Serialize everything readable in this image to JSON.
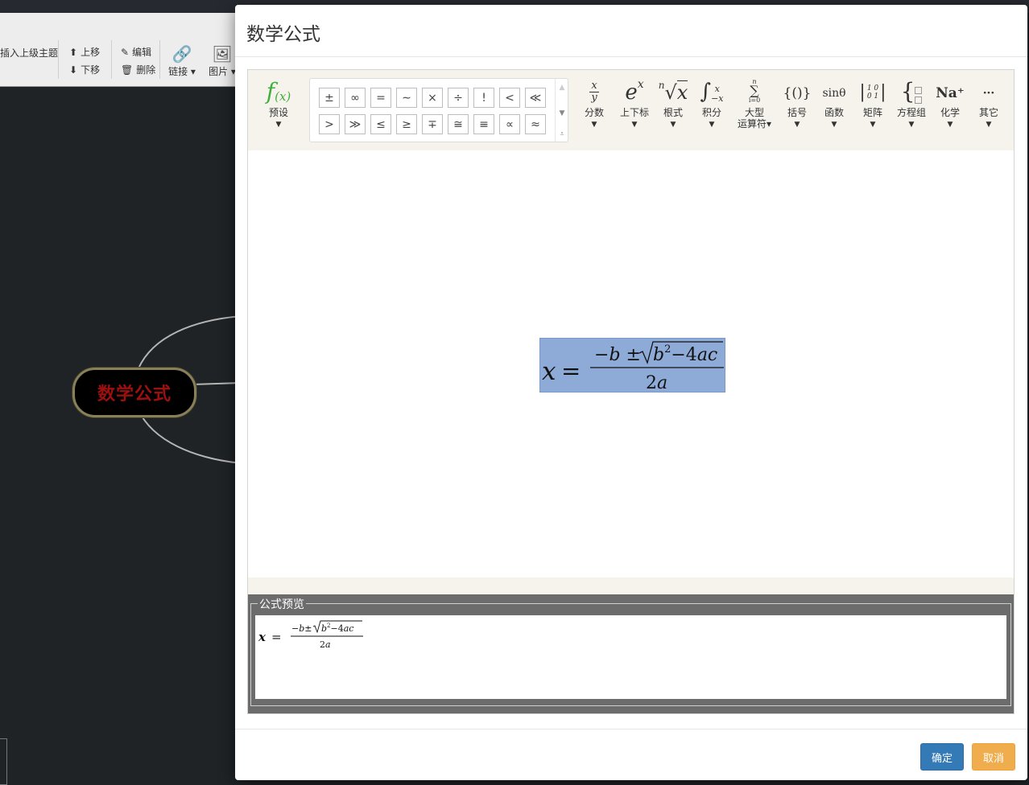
{
  "app_toolbar": {
    "insert_parent_label": "插入上级主题",
    "move_up_label": "上移",
    "move_down_label": "下移",
    "edit_label": "编辑",
    "delete_label": "删除",
    "link_label": "链接",
    "image_label": "图片"
  },
  "mindmap": {
    "central_node": "数学公式"
  },
  "dialog": {
    "title": "数学公式",
    "preview_legend": "公式预览",
    "ok_label": "确定",
    "cancel_label": "取消"
  },
  "formula_toolbar": {
    "preset_label": "预设",
    "items": [
      {
        "label": "分数"
      },
      {
        "label": "上下标"
      },
      {
        "label": "根式"
      },
      {
        "label": "积分"
      },
      {
        "label": "大型",
        "label2": "运算符"
      },
      {
        "label": "括号"
      },
      {
        "label": "函数"
      },
      {
        "label": "矩阵"
      },
      {
        "label": "方程组"
      },
      {
        "label": "化学"
      },
      {
        "label": "其它"
      }
    ],
    "function_icon_text": "sinθ",
    "chem_icon_text": "Na⁺",
    "other_icon_text": "···"
  },
  "symbols": [
    "±",
    "∞",
    "=",
    "∼",
    "×",
    "÷",
    "!",
    "<",
    "≪",
    ">",
    "≫",
    "≤",
    "≥",
    "∓",
    "≅",
    "≡",
    "∝",
    "≈"
  ],
  "formula": {
    "latex": "x=\\frac{-b\\pm\\sqrt{b^2-4ac}}{2a}"
  },
  "colors": {
    "selection": "#8eabd8",
    "node_text": "#9c1010",
    "ok_button": "#337ab7",
    "cancel_button": "#f0ad4e"
  }
}
